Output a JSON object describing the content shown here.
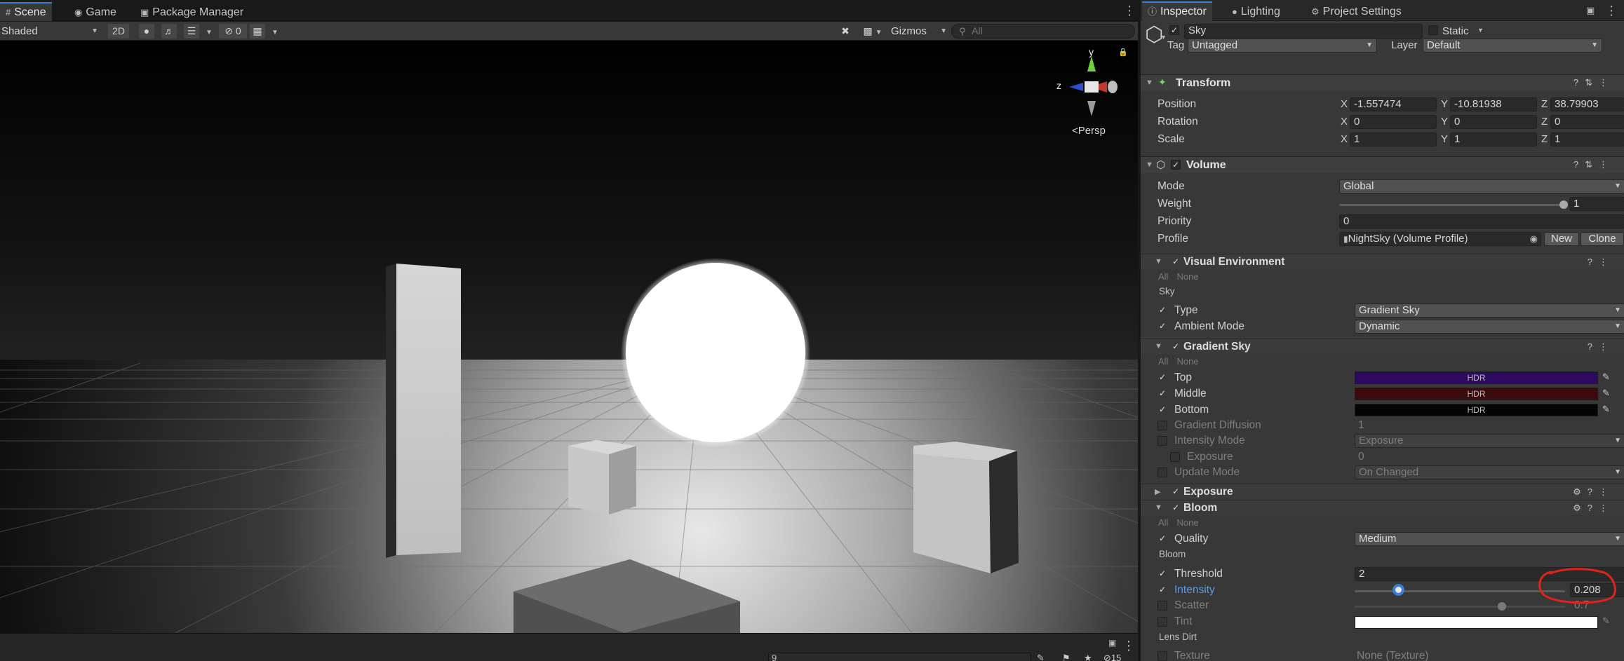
{
  "scene": {
    "tabs": [
      {
        "label": "Scene",
        "icon": "grid-icon"
      },
      {
        "label": "Game",
        "icon": "gamepad-icon"
      },
      {
        "label": "Package Manager",
        "icon": "package-icon"
      }
    ],
    "toolbar": {
      "draw_mode": "Shaded",
      "mode_2d": "2D",
      "hidden_count": "0",
      "gizmos": "Gizmos",
      "search_placeholder": "All"
    },
    "gizmo": {
      "y_label": "y",
      "z_label": "z",
      "projection": "Persp"
    },
    "bottom": {
      "search_value": "9",
      "layer_count": "15"
    }
  },
  "inspector": {
    "tabs": [
      {
        "label": "Inspector",
        "icon": "info-icon"
      },
      {
        "label": "Lighting",
        "icon": "bulb-icon"
      },
      {
        "label": "Project Settings",
        "icon": "gear-icon"
      }
    ],
    "object": {
      "name": "Sky",
      "static_label": "Static",
      "tag_label": "Tag",
      "tag_value": "Untagged",
      "layer_label": "Layer",
      "layer_value": "Default"
    },
    "transform": {
      "title": "Transform",
      "position_label": "Position",
      "rotation_label": "Rotation",
      "scale_label": "Scale",
      "axis_x": "X",
      "axis_y": "Y",
      "axis_z": "Z",
      "position": {
        "x": "-1.557474",
        "y": "-10.81938",
        "z": "38.79903"
      },
      "rotation": {
        "x": "0",
        "y": "0",
        "z": "0"
      },
      "scale": {
        "x": "1",
        "y": "1",
        "z": "1"
      }
    },
    "volume": {
      "title": "Volume",
      "mode_label": "Mode",
      "mode_value": "Global",
      "weight_label": "Weight",
      "weight_value": "1",
      "weight_fraction": 1.0,
      "priority_label": "Priority",
      "priority_value": "0",
      "profile_label": "Profile",
      "profile_value": "NightSky (Volume Profile)",
      "new_button": "New",
      "clone_button": "Clone"
    },
    "all_label": "All",
    "none_label": "None",
    "visual_environment": {
      "title": "Visual Environment",
      "section": "Sky",
      "type_label": "Type",
      "type_value": "Gradient Sky",
      "ambient_label": "Ambient Mode",
      "ambient_value": "Dynamic"
    },
    "gradient_sky": {
      "title": "Gradient Sky",
      "top_label": "Top",
      "middle_label": "Middle",
      "bottom_label": "Bottom",
      "hdr_label": "HDR",
      "top_color": "#2c0a5e",
      "middle_color": "#3a0a0e",
      "bottom_color": "#050505",
      "diffusion_label": "Gradient Diffusion",
      "diffusion_value": "1",
      "intensity_mode_label": "Intensity Mode",
      "intensity_mode_value": "Exposure",
      "exposure_label": "Exposure",
      "exposure_value": "0",
      "update_mode_label": "Update Mode",
      "update_mode_value": "On Changed"
    },
    "exposure": {
      "title": "Exposure"
    },
    "bloom": {
      "title": "Bloom",
      "quality_label": "Quality",
      "quality_value": "Medium",
      "section": "Bloom",
      "threshold_label": "Threshold",
      "threshold_value": "2",
      "intensity_label": "Intensity",
      "intensity_value": "0.208",
      "intensity_fraction": 0.208,
      "scatter_label": "Scatter",
      "scatter_value": "0.7",
      "scatter_fraction": 0.7,
      "tint_label": "Tint",
      "tint_color": "#ffffff",
      "lens_dirt_section": "Lens Dirt",
      "texture_label": "Texture",
      "texture_value": "None (Texture)"
    }
  }
}
